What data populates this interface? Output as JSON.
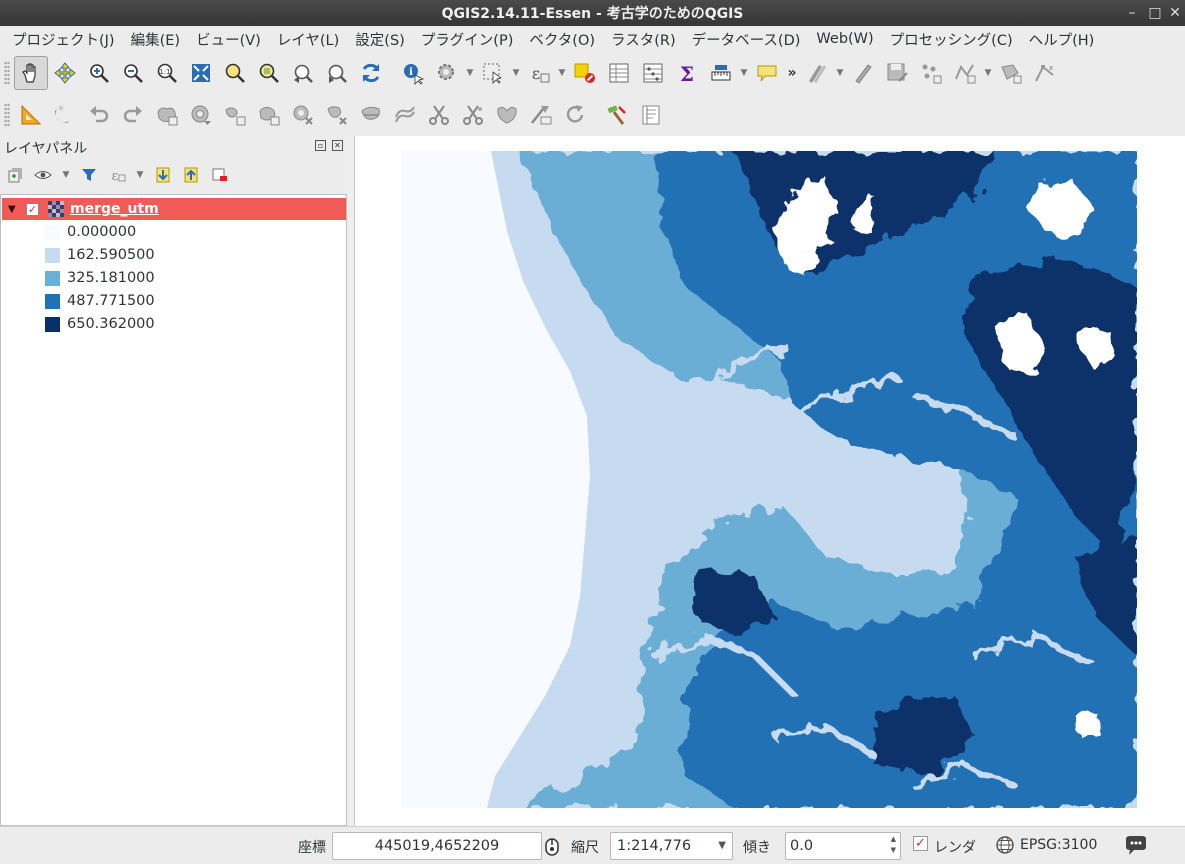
{
  "window": {
    "title": "QGIS2.14.11-Essen - 考古学のためのQGIS"
  },
  "menu": [
    "プロジェクト(J)",
    "編集(E)",
    "ビュー(V)",
    "レイヤ(L)",
    "設定(S)",
    "プラグイン(P)",
    "ベクタ(O)",
    "ラスタ(R)",
    "データベース(D)",
    "Web(W)",
    "プロセッシング(C)",
    "ヘルプ(H)"
  ],
  "toolbar_more": "»",
  "layers_panel": {
    "title": "レイヤパネル",
    "layer": {
      "name": "merge_utm",
      "visible": true
    },
    "legend": [
      {
        "value": "0.000000",
        "color": "#f7fbff"
      },
      {
        "value": "162.590500",
        "color": "#c6dbef"
      },
      {
        "value": "325.181000",
        "color": "#6baed6"
      },
      {
        "value": "487.771500",
        "color": "#2171b5"
      },
      {
        "value": "650.362000",
        "color": "#08306b"
      }
    ]
  },
  "status": {
    "coord_label": "座標",
    "coord_value": "445019,4652209",
    "scale_label": "縮尺",
    "scale_value": "1:214,776",
    "rotation_label": "傾き",
    "rotation_value": "0.0",
    "render_label": "レンダ",
    "render_checked": true,
    "crs": "EPSG:3100"
  }
}
